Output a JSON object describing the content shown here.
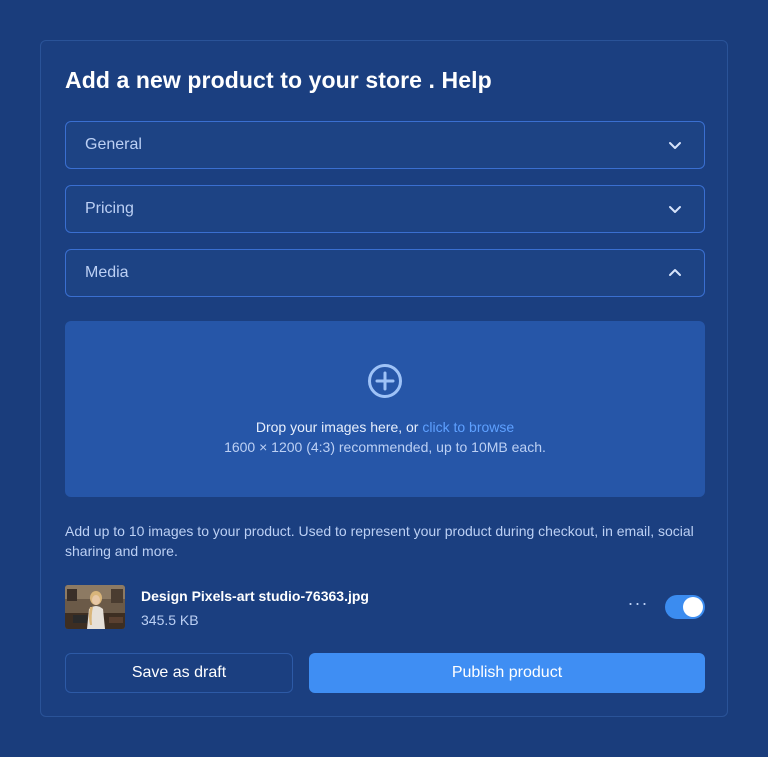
{
  "title": "Add a new product to your store . Help",
  "accordions": [
    {
      "label": "General",
      "state": "collapsed",
      "icon": "chevron-down-icon"
    },
    {
      "label": "Pricing",
      "state": "collapsed",
      "icon": "chevron-down-icon"
    },
    {
      "label": "Media",
      "state": "expanded",
      "icon": "chevron-up-icon"
    }
  ],
  "dropzone": {
    "icon": "plus-circle-icon",
    "text": "Drop your images here, or ",
    "link": "click to browse",
    "hint": "1600 × 1200 (4:3) recommended, up to 10MB each."
  },
  "help_text": "Add up to 10 images to your product. Used to represent your product during checkout, in email, social sharing and more.",
  "file": {
    "name": "Design Pixels-art studio-76363.jpg",
    "size": "345.5 KB",
    "more": "···",
    "toggle_on": true
  },
  "buttons": {
    "draft": "Save as draft",
    "publish": "Publish product"
  },
  "colors": {
    "background": "#1a3d7c",
    "dropzone": "#2656a8",
    "accent": "#3f8ef3",
    "link": "#5ea0ff"
  }
}
